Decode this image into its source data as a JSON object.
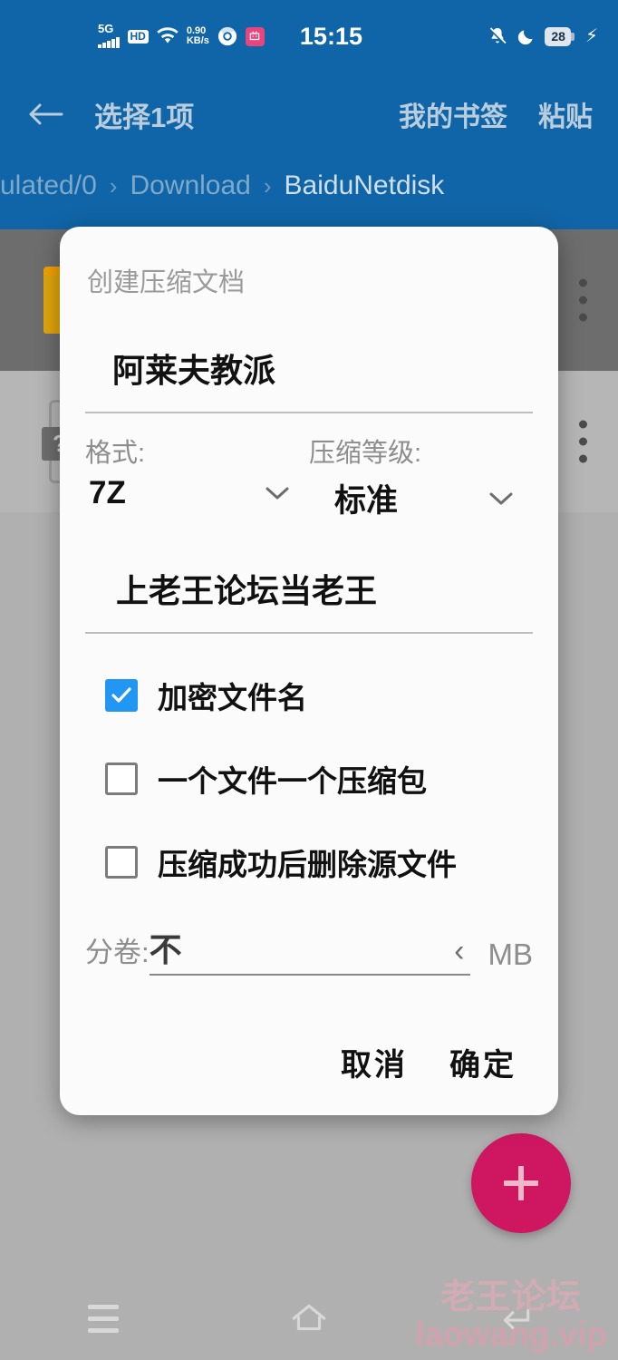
{
  "statusbar": {
    "network_label": "5G",
    "hd_label": "HD",
    "wifi_icon": "wifi-icon",
    "speed_value": "0.90",
    "speed_unit": "KB/s",
    "chrome_icon": "chrome-icon",
    "bilibili_icon": "bilibili-icon",
    "time": "15:15",
    "mute_icon": "bell-muted-icon",
    "dnd_icon": "moon-icon",
    "battery_percent": "28",
    "charging_icon": "bolt-icon"
  },
  "appbar": {
    "back_icon": "back-arrow-icon",
    "title": "选择1项",
    "actions": [
      {
        "label": "我的书签",
        "name": "my-bookmarks-action"
      },
      {
        "label": "粘贴",
        "name": "paste-action"
      }
    ],
    "breadcrumb": [
      {
        "label": "ulated/0",
        "active": false
      },
      {
        "label": "Download",
        "active": false
      },
      {
        "label": "BaiduNetdisk",
        "active": true
      }
    ],
    "breadcrumb_separator": "›"
  },
  "filelist": {
    "rows": [
      {
        "type": "folder",
        "selected": true,
        "icon": "folder-icon",
        "overflow_icon": "more-vertical-icon"
      },
      {
        "type": "file",
        "selected": false,
        "icon": "file-unknown-icon",
        "badge": "?",
        "overflow_icon": "more-vertical-icon"
      }
    ]
  },
  "dialog": {
    "title": "创建压缩文档",
    "archive_name": "阿莱夫教派",
    "format": {
      "label": "格式:",
      "value": "7Z",
      "caret_icon": "chevron-down-icon"
    },
    "level": {
      "label": "压缩等级:",
      "value": "标准",
      "caret_icon": "chevron-down-icon"
    },
    "password": "上老王论坛当老王",
    "checkboxes": [
      {
        "label": "加密文件名",
        "checked": true,
        "name": "encrypt-filenames-checkbox"
      },
      {
        "label": "一个文件一个压缩包",
        "checked": false,
        "name": "one-archive-per-file-checkbox"
      },
      {
        "label": "压缩成功后删除源文件",
        "checked": false,
        "name": "delete-source-after-checkbox"
      }
    ],
    "split": {
      "label": "分卷:",
      "value": "不",
      "chevron_icon": "chevron-left-icon",
      "unit": "MB"
    },
    "buttons": {
      "cancel": "取消",
      "confirm": "确定"
    }
  },
  "fab": {
    "icon": "plus-icon"
  },
  "watermark": {
    "line1": "老王论坛",
    "line2": "laowang.vip"
  },
  "navbar": {
    "recents_icon": "recents-icon",
    "home_icon": "home-icon",
    "back_icon": "back-icon"
  },
  "colors": {
    "appbar_blue": "#1065a8",
    "accent_pink": "#cf1761",
    "checkbox_blue": "#2196f3",
    "folder_orange": "#e0a60b",
    "selected_row": "#6d6d6d",
    "normal_row": "#b6b6b6",
    "watermark_pink": "#f0a8b8"
  }
}
